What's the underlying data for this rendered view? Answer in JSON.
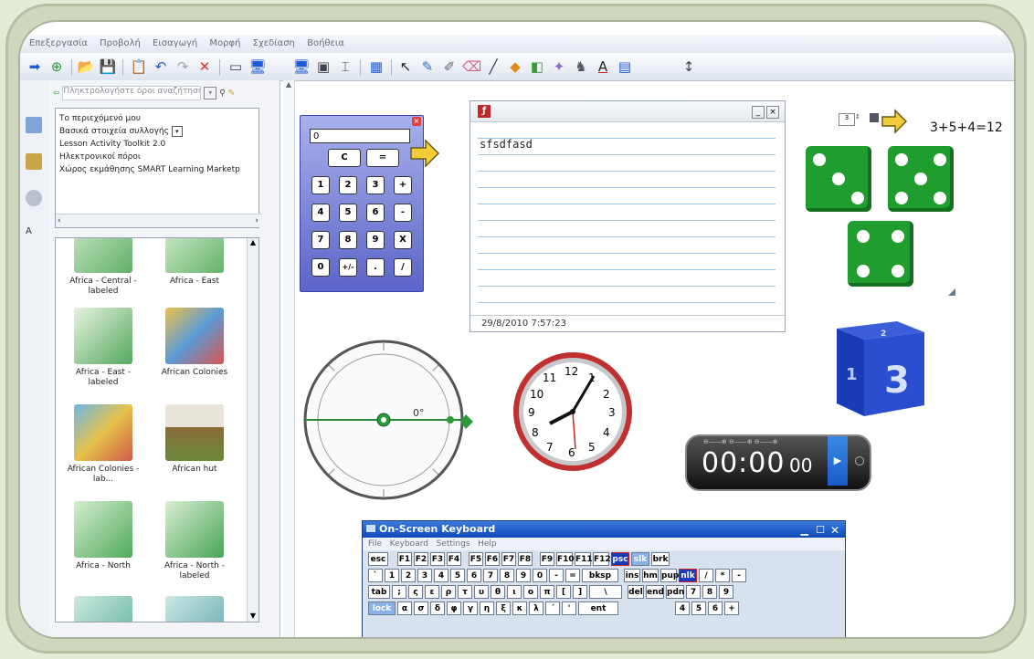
{
  "menu": [
    "Επεξεργασία",
    "Προβολή",
    "Εισαγωγή",
    "Μορφή",
    "Σχεδίαση",
    "Βοήθεια"
  ],
  "search": {
    "placeholder": "Πληκτρολογήστε όροι αναζήτησης"
  },
  "tree_items": [
    "Το περιεχόμενό μου",
    "Βασικά στοιχεία συλλογής",
    "Lesson Activity Toolkit 2.0",
    "Ηλεκτρονικοί πόροι",
    "Χώρος εκμάθησης SMART Learning Marketp"
  ],
  "gallery": [
    {
      "label": "Africa - Central - labeled"
    },
    {
      "label": "Africa - East"
    },
    {
      "label": "Africa - East - labeled"
    },
    {
      "label": "African Colonies"
    },
    {
      "label": "African Colonies - lab..."
    },
    {
      "label": "African hut"
    },
    {
      "label": "Africa - North"
    },
    {
      "label": "Africa - North - labeled"
    }
  ],
  "calculator": {
    "display": "0",
    "keys": [
      "C",
      "=",
      "1",
      "2",
      "3",
      "+",
      "4",
      "5",
      "6",
      "-",
      "7",
      "8",
      "9",
      "X",
      "0",
      "+/-",
      ".",
      "/"
    ]
  },
  "notepad": {
    "text": "sfsdfasd",
    "timestamp": "29/8/2010 7:57:23"
  },
  "equation": "3+5+4=12",
  "dice": [
    {
      "pips": 3
    },
    {
      "pips": 5
    },
    {
      "pips": 4
    }
  ],
  "cube": {
    "face": "3",
    "top": "2",
    "side": "1"
  },
  "protractor": {
    "angle": "0°"
  },
  "clock": {
    "numbers": [
      "12",
      "1",
      "2",
      "3",
      "4",
      "5",
      "6",
      "7",
      "8",
      "9",
      "10",
      "11"
    ]
  },
  "timer": {
    "display": "00:00",
    "small": "00"
  },
  "osk": {
    "title": "On-Screen Keyboard",
    "menu": [
      "File",
      "Keyboard",
      "Settings",
      "Help"
    ],
    "row1": [
      "esc",
      "F1",
      "F2",
      "F3",
      "F4",
      "F5",
      "F6",
      "F7",
      "F8",
      "F9",
      "F10",
      "F11",
      "F12",
      "psc",
      "slk",
      "brk"
    ],
    "row2": [
      "`",
      "1",
      "2",
      "3",
      "4",
      "5",
      "6",
      "7",
      "8",
      "9",
      "0",
      "-",
      "=",
      "bksp",
      "ins",
      "hm",
      "pup",
      "nlk",
      "/",
      "*",
      "-"
    ],
    "row3": [
      "tab",
      ";",
      "ς",
      "ε",
      "ρ",
      "τ",
      "υ",
      "θ",
      "ι",
      "ο",
      "π",
      "[",
      "]",
      "\\",
      "del",
      "end",
      "pdn",
      "7",
      "8",
      "9"
    ],
    "row4": [
      "lock",
      "α",
      "σ",
      "δ",
      "φ",
      "γ",
      "η",
      "ξ",
      "κ",
      "λ",
      "΄",
      "'",
      "ent",
      "4",
      "5",
      "6",
      "+"
    ]
  }
}
